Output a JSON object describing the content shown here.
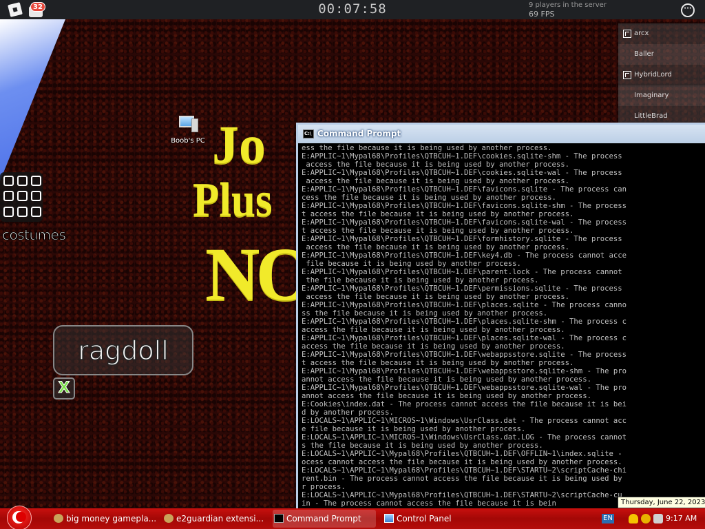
{
  "topbar": {
    "chat_badge": "32",
    "timer": "00:07:58",
    "players_in_server": "9 players in the server",
    "fps": "69 FPS"
  },
  "playerlist": [
    {
      "name": "arcx",
      "icon": true
    },
    {
      "name": "Baller",
      "icon": false
    },
    {
      "name": "HybridLord",
      "icon": true
    },
    {
      "name": "Imaginary",
      "icon": false
    },
    {
      "name": "LittleBrad",
      "icon": false
    }
  ],
  "desktop_icon": {
    "label": "Boob's PC"
  },
  "graffiti": {
    "line1": "Jo",
    "line2": "Plus",
    "line3": "NO"
  },
  "costumes": {
    "label": "costumes"
  },
  "ragdoll": {
    "label": "ragdoll",
    "close": "X"
  },
  "cmd": {
    "title": "Command Prompt",
    "icon_text": "C:\\",
    "lines": [
      "ess the file because it is being used by another process.",
      "E:APPLIC~1\\Mypal68\\Profiles\\QTBCUH~1.DEF\\cookies.sqlite-shm - The process",
      " access the file because it is being used by another process.",
      "E:APPLIC~1\\Mypal68\\Profiles\\QTBCUH~1.DEF\\cookies.sqlite-wal - The process",
      " access the file because it is being used by another process.",
      "E:APPLIC~1\\Mypal68\\Profiles\\QTBCUH~1.DEF\\favicons.sqlite - The process can",
      "cess the file because it is being used by another process.",
      "E:APPLIC~1\\Mypal68\\Profiles\\QTBCUH~1.DEF\\favicons.sqlite-shm - The process",
      "t access the file because it is being used by another process.",
      "E:APPLIC~1\\Mypal68\\Profiles\\QTBCUH~1.DEF\\favicons.sqlite-wal - The process",
      "t access the file because it is being used by another process.",
      "E:APPLIC~1\\Mypal68\\Profiles\\QTBCUH~1.DEF\\formhistory.sqlite - The process",
      " access the file because it is being used by another process.",
      "E:APPLIC~1\\Mypal68\\Profiles\\QTBCUH~1.DEF\\key4.db - The process cannot acce",
      " file because it is being used by another process.",
      "E:APPLIC~1\\Mypal68\\Profiles\\QTBCUH~1.DEF\\parent.lock - The process cannot",
      " the file because it is being used by another process.",
      "E:APPLIC~1\\Mypal68\\Profiles\\QTBCUH~1.DEF\\permissions.sqlite - The process",
      " access the file because it is being used by another process.",
      "E:APPLIC~1\\Mypal68\\Profiles\\QTBCUH~1.DEF\\places.sqlite - The process canno",
      "ss the file because it is being used by another process.",
      "E:APPLIC~1\\Mypal68\\Profiles\\QTBCUH~1.DEF\\places.sqlite-shm - The process c",
      "access the file because it is being used by another process.",
      "E:APPLIC~1\\Mypal68\\Profiles\\QTBCUH~1.DEF\\places.sqlite-wal - The process c",
      "access the file because it is being used by another process.",
      "E:APPLIC~1\\Mypal68\\Profiles\\QTBCUH~1.DEF\\webappsstore.sqlite - The process",
      "t access the file because it is being used by another process.",
      "E:APPLIC~1\\Mypal68\\Profiles\\QTBCUH~1.DEF\\webappsstore.sqlite-shm - The pro",
      "annot access the file because it is being used by another process.",
      "E:APPLIC~1\\Mypal68\\Profiles\\QTBCUH~1.DEF\\webappsstore.sqlite-wal - The pro",
      "annot access the file because it is being used by another process.",
      "E:Cookies\\index.dat - The process cannot access the file because it is bei",
      "d by another process.",
      "E:LOCALS~1\\APPLIC~1\\MICROS~1\\Windows\\UsrClass.dat - The process cannot acc",
      "e file because it is being used by another process.",
      "E:LOCALS~1\\APPLIC~1\\MICROS~1\\Windows\\UsrClass.dat.LOG - The process cannot",
      "s the file because it is being used by another process.",
      "E:LOCALS~1\\APPLIC~1\\Mypal68\\Profiles\\QTBCUH~1.DEF\\OFFLIN~1\\index.sqlite -",
      "ocess cannot access the file because it is being used by another process.",
      "E:LOCALS~1\\APPLIC~1\\Mypal68\\Profiles\\QTBCUH~1.DEF\\STARTU~2\\scriptCache-chi",
      "rent.bin - The process cannot access the file because it is being used by",
      "r process.",
      "E:LOCALS~1\\APPLIC~1\\Mypal68\\Profiles\\QTBCUH~1.DEF\\STARTU~2\\scriptCache-cu",
      "in - The process cannot access the file because it is bein"
    ]
  },
  "taskbar": {
    "items": [
      {
        "label": "big money gamepla...",
        "active": false
      },
      {
        "label": "e2guardian extensi...",
        "active": false
      },
      {
        "label": "Command Prompt",
        "active": true
      },
      {
        "label": "Control Panel",
        "active": false
      }
    ],
    "language": "EN",
    "clock": "9:17 AM",
    "tooltip": "Thursday, June 22, 2023"
  }
}
